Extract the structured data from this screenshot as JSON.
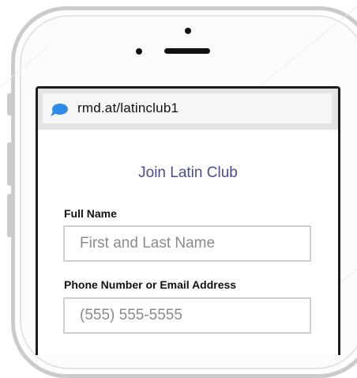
{
  "browser": {
    "url": "rmd.at/latinclub1",
    "icon": "speech-bubble-icon",
    "icon_color": "#2d8ae6"
  },
  "form": {
    "title": "Join Latin Club",
    "title_color": "#4b4b9a",
    "full_name": {
      "label": "Full Name",
      "placeholder": "First and Last Name"
    },
    "contact": {
      "label": "Phone Number or Email Address",
      "placeholder": "(555) 555-5555"
    }
  }
}
